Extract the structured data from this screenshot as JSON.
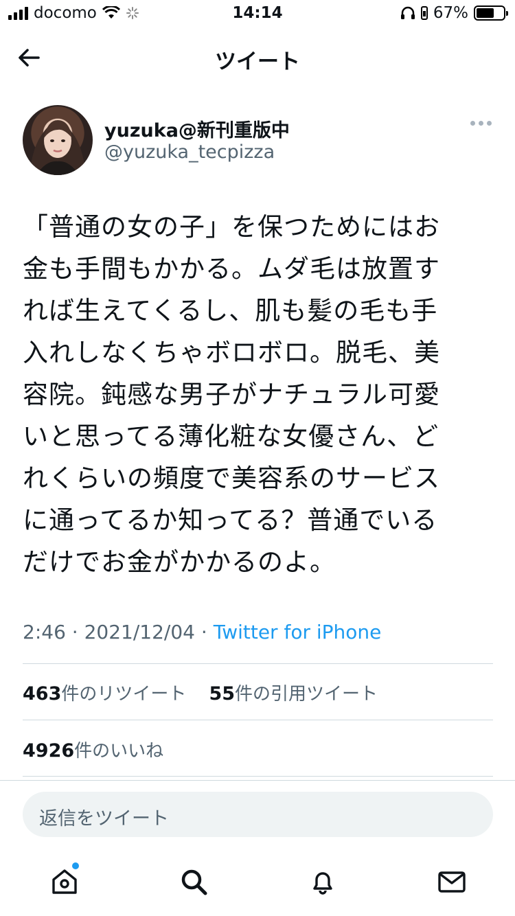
{
  "status_bar": {
    "carrier": "docomo",
    "time": "14:14",
    "battery": "67%",
    "battery_level": 0.67
  },
  "header": {
    "title": "ツイート",
    "back_icon": "arrow-left-icon"
  },
  "tweet": {
    "author_name": "yuzuka@新刊重版中",
    "author_handle": "@yuzuka_tecpizza",
    "text_lines": [
      "「普通の女の子」を保つためにはお",
      "金も手間もかかる。ムダ毛は放置す",
      "れば生えてくるし、肌も髪の毛も手",
      "入れしなくちゃボロボロ。脱毛、美",
      "容院。鈍感な男子がナチュラル可愛",
      "いと思ってる薄化粧な女優さん、ど",
      "れくらいの頻度で美容系のサービス",
      "に通ってるか知ってる？普通でいる",
      "だけでお金がかかるのよ。"
    ],
    "time": "2:46",
    "date": "2021/12/04",
    "source": "Twitter for iPhone"
  },
  "stats": {
    "retweets_count": "463",
    "retweets_label": "件のリツイート",
    "quotes_count": "55",
    "quotes_label": "件の引用ツイート",
    "likes_count": "4926",
    "likes_label": "件のいいね"
  },
  "reply": {
    "placeholder": "返信をツイート"
  },
  "tabbar": {
    "items": [
      "home-icon",
      "search-icon",
      "notifications-icon",
      "messages-icon"
    ]
  },
  "colors": {
    "accent": "#1d9bf0",
    "muted": "#536471",
    "text": "#0f1419",
    "divider": "#cfd9de"
  }
}
